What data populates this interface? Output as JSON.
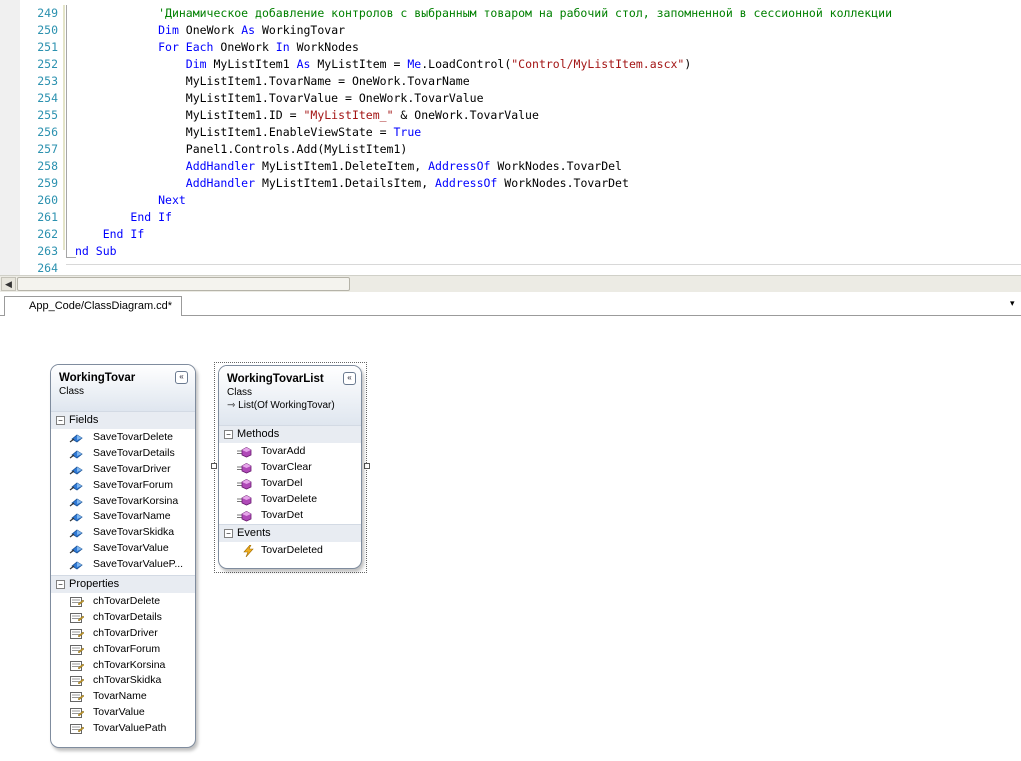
{
  "editor": {
    "line_numbers": [
      "249",
      "250",
      "251",
      "252",
      "253",
      "254",
      "255",
      "256",
      "257",
      "258",
      "259",
      "260",
      "261",
      "262",
      "263",
      "264"
    ],
    "lines": [
      [
        {
          "t": "            "
        },
        {
          "t": "'Динамическое добавление контролов с выбранным товаром на рабочий стол, запомненной в сессионной коллекции",
          "c": "cm"
        }
      ],
      [
        {
          "t": "            "
        },
        {
          "t": "Dim",
          "c": "kw"
        },
        {
          "t": " OneWork "
        },
        {
          "t": "As",
          "c": "kw"
        },
        {
          "t": " WorkingTovar"
        }
      ],
      [
        {
          "t": "            "
        },
        {
          "t": "For Each",
          "c": "kw"
        },
        {
          "t": " OneWork "
        },
        {
          "t": "In",
          "c": "kw"
        },
        {
          "t": " WorkNodes"
        }
      ],
      [
        {
          "t": "                "
        },
        {
          "t": "Dim",
          "c": "kw"
        },
        {
          "t": " MyListItem1 "
        },
        {
          "t": "As",
          "c": "kw"
        },
        {
          "t": " MyListItem = "
        },
        {
          "t": "Me",
          "c": "kw"
        },
        {
          "t": ".LoadControl("
        },
        {
          "t": "\"Control/MyListItem.ascx\"",
          "c": "str"
        },
        {
          "t": ")"
        }
      ],
      [
        {
          "t": "                MyListItem1.TovarName = OneWork.TovarName"
        }
      ],
      [
        {
          "t": "                MyListItem1.TovarValue = OneWork.TovarValue"
        }
      ],
      [
        {
          "t": "                MyListItem1.ID = "
        },
        {
          "t": "\"MyListItem_\"",
          "c": "str"
        },
        {
          "t": " & OneWork.TovarValue"
        }
      ],
      [
        {
          "t": "                MyListItem1.EnableViewState = "
        },
        {
          "t": "True",
          "c": "kw"
        }
      ],
      [
        {
          "t": "                Panel1.Controls.Add(MyListItem1)"
        }
      ],
      [
        {
          "t": "                "
        },
        {
          "t": "AddHandler",
          "c": "kw"
        },
        {
          "t": " MyListItem1.DeleteItem, "
        },
        {
          "t": "AddressOf",
          "c": "kw"
        },
        {
          "t": " WorkNodes.TovarDel"
        }
      ],
      [
        {
          "t": "                "
        },
        {
          "t": "AddHandler",
          "c": "kw"
        },
        {
          "t": " MyListItem1.DetailsItem, "
        },
        {
          "t": "AddressOf",
          "c": "kw"
        },
        {
          "t": " WorkNodes.TovarDet"
        }
      ],
      [
        {
          "t": "            "
        },
        {
          "t": "Next",
          "c": "kw"
        }
      ],
      [
        {
          "t": "        "
        },
        {
          "t": "End If",
          "c": "kw"
        }
      ],
      [
        {
          "t": "    "
        },
        {
          "t": "End If",
          "c": "kw"
        }
      ],
      [
        {
          "t": "nd Sub",
          "c": "kw"
        }
      ],
      [
        {
          "t": ""
        }
      ]
    ]
  },
  "tab": {
    "label": "App_Code/ClassDiagram.cd*",
    "dropdown_glyph": "▾"
  },
  "scrollbar": {
    "left_arrow": "◀"
  },
  "class_working_tovar": {
    "name": "WorkingTovar",
    "kind": "Class",
    "collapse_glyph": "«",
    "fields_label": "Fields",
    "fields": [
      "SaveTovarDelete",
      "SaveTovarDetails",
      "SaveTovarDriver",
      "SaveTovarForum",
      "SaveTovarKorsina",
      "SaveTovarName",
      "SaveTovarSkidka",
      "SaveTovarValue",
      "SaveTovarValueP..."
    ],
    "properties_label": "Properties",
    "properties": [
      "chTovarDelete",
      "chTovarDetails",
      "chTovarDriver",
      "chTovarForum",
      "chTovarKorsina",
      "chTovarSkidka",
      "TovarName",
      "TovarValue",
      "TovarValuePath"
    ]
  },
  "class_working_tovar_list": {
    "name": "WorkingTovarList",
    "kind": "Class",
    "base": "List(Of WorkingTovar)",
    "collapse_glyph": "«",
    "methods_label": "Methods",
    "methods": [
      "TovarAdd",
      "TovarClear",
      "TovarDel",
      "TovarDelete",
      "TovarDet"
    ],
    "events_label": "Events",
    "events": [
      "TovarDeleted"
    ]
  },
  "section_toggle_glyph": "−",
  "colors": {
    "keyword": "#0000ff",
    "string": "#a31515",
    "comment": "#008000",
    "line_number": "#2b91af",
    "shape_border": "#7f8c9e"
  },
  "icons": {
    "field": "field-icon",
    "property": "property-icon",
    "method": "method-icon",
    "event": "event-icon",
    "inherits": "inherits-arrow-icon"
  }
}
